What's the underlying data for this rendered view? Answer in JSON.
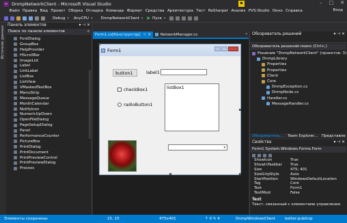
{
  "window": {
    "title": "DnmpNetworkClient - Microsoft Visual Studio",
    "window_buttons": [
      "–",
      "□",
      "✕"
    ]
  },
  "menu": {
    "items": [
      "Файл",
      "Правка",
      "Вид",
      "Проект",
      "Сборка",
      "Отладка",
      "Команда",
      "Формат",
      "Средства",
      "Архитектура",
      "Тест",
      "ReSharper",
      "Анализ",
      "PVS-Studio",
      "Окно",
      "Справка"
    ],
    "login": "Вход"
  },
  "toolbar": {
    "config": "Debug",
    "platform": "AnyCPU",
    "project": "DnmpNetworkClient",
    "start": "Пуск"
  },
  "toolbox": {
    "side_tab": "Источник данных",
    "title": "Панель элементов",
    "search": "Поиск по панели элементов",
    "items": [
      "FontDialog",
      "GroupBox",
      "HelpProvider",
      "HScrollBar",
      "ImageList",
      "Label",
      "LinkLabel",
      "ListBox",
      "ListView",
      "VMaskedTextBox",
      "MenuStrip",
      "MessageQueue",
      "MonthCalendar",
      "NotifyIcon",
      "NumericUpDown",
      "OpenFileDialog",
      "PageSetupDialog",
      "Panel",
      "PerformanceCounter",
      "PictureBox",
      "PrintDialog",
      "PrintDocument",
      "PrintPreviewControl",
      "PrintPreviewDialog",
      "Process"
    ]
  },
  "doc_tabs": [
    {
      "label": "Form1.cs[Конструктор]",
      "active": true
    },
    {
      "label": "NetworkManager.cs",
      "active": false
    }
  ],
  "form": {
    "title": "Form1",
    "button1": "button1",
    "label1": "label1",
    "checkbox1": "checkBox1",
    "radiobutton1": "radioButton1",
    "listbox1": "listBox1"
  },
  "solution_explorer": {
    "title": "Обозреватель решений",
    "search": "Обозреватель решений-поиск (Ctrl+;)",
    "nodes": [
      {
        "label": "Решение \"DnmpNetworkClient\" (проектов: 3)",
        "indent": 0
      },
      {
        "label": "DnmpLibrary",
        "indent": 1
      },
      {
        "label": "Properties",
        "indent": 2
      },
      {
        "label": "Properties",
        "indent": 2
      },
      {
        "label": "Client",
        "indent": 2
      },
      {
        "label": "Core",
        "indent": 2
      },
      {
        "label": "DnmpException.cs",
        "indent": 3
      },
      {
        "label": "DnmpNode.cs",
        "indent": 3
      },
      {
        "label": "Handler.cs",
        "indent": 2
      },
      {
        "label": "MessageHandler.cs",
        "indent": 3
      }
    ],
    "tabs": [
      "Обозреватель...",
      "Team Explorer...",
      "Представле"
    ]
  },
  "properties": {
    "title": "Свойства",
    "object": "Form1 System.Windows.Forms.Form",
    "rows": [
      {
        "key": "ShowIcon",
        "value": "True"
      },
      {
        "key": "ShowInTaskbar",
        "value": "True"
      },
      {
        "key": "Size",
        "value": "475; 401"
      },
      {
        "key": "SizeGripStyle",
        "value": "Auto"
      },
      {
        "key": "StartPosition",
        "value": "WindowsDefaultLocation"
      },
      {
        "key": "Tag",
        "value": "Core"
      },
      {
        "key": "Text",
        "value": "Form1"
      },
      {
        "key": "TextMost",
        "value": "False"
      }
    ],
    "desc_title": "Text",
    "desc_text": "Текст, связанный с элементами управления."
  },
  "status": {
    "message": "Элементы сохранены",
    "position": "15, 15",
    "size": "475x401",
    "project": "DnmpWindowsClient",
    "branch": "better-publicip"
  },
  "colors": {
    "accent": "#007acc",
    "chrome": "#2d2d30",
    "panel": "#252526"
  }
}
